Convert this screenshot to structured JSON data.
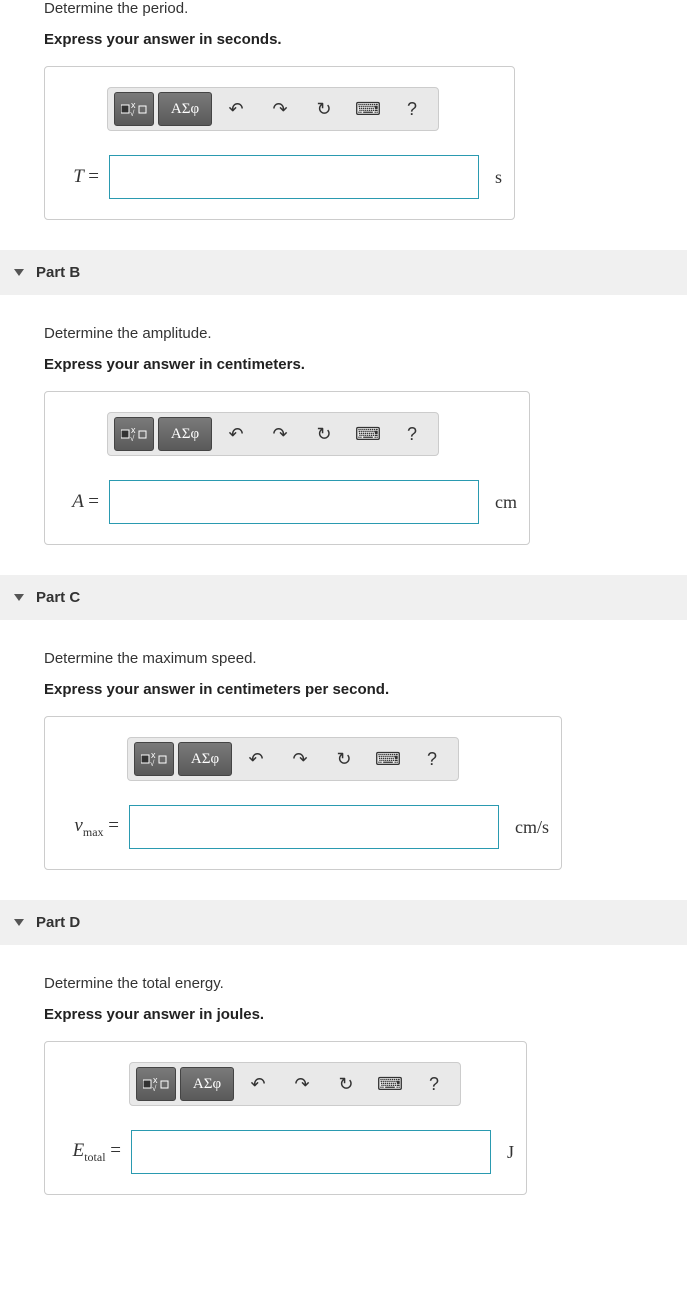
{
  "parts": [
    {
      "title": "",
      "prompt": "Determine the period.",
      "instruction": "Express your answer in seconds.",
      "variable_html": "T",
      "unit": "s",
      "greek": "ΑΣφ"
    },
    {
      "title": "Part B",
      "prompt": "Determine the amplitude.",
      "instruction": "Express your answer in centimeters.",
      "variable_html": "A",
      "unit": "cm",
      "greek": "ΑΣφ"
    },
    {
      "title": "Part C",
      "prompt": "Determine the maximum speed.",
      "instruction": "Express your answer in centimeters per second.",
      "variable_html": "v<sub class='sub'>max</sub>",
      "unit": "cm/s",
      "greek": "ΑΣφ"
    },
    {
      "title": "Part D",
      "prompt": "Determine the total energy.",
      "instruction": "Express your answer in joules.",
      "variable_html": "E<sub class='sub'>total</sub>",
      "unit": "J",
      "greek": "ΑΣφ"
    }
  ],
  "toolbar_labels": {
    "templates": "templates-icon",
    "greek": "greek-button",
    "undo": "undo-button",
    "redo": "redo-button",
    "reset": "reset-button",
    "keyboard": "keyboard-button",
    "help": "help-button"
  },
  "help_glyph": "?"
}
